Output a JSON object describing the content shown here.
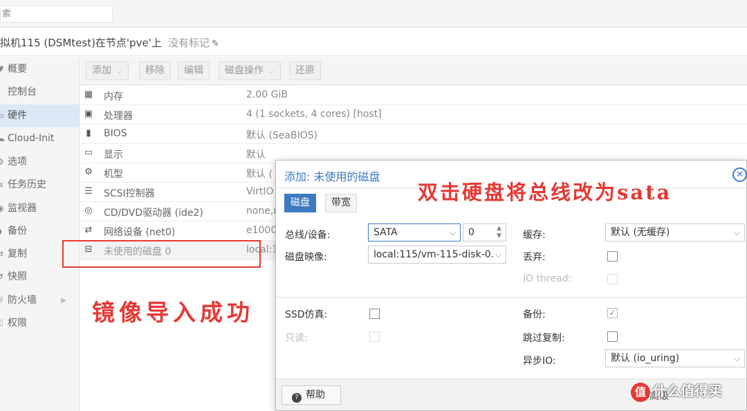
{
  "topbar": {
    "search_text": "索"
  },
  "header": {
    "vm_title": "拟机115 (DSMtest)在节点'pve'上",
    "tag_text": "没有标记"
  },
  "nav": {
    "items": [
      {
        "label": "概要"
      },
      {
        "label": "控制台"
      },
      {
        "label": "硬件"
      },
      {
        "label": "Cloud-Init"
      },
      {
        "label": "选项"
      },
      {
        "label": "任务历史"
      },
      {
        "label": "监视器"
      },
      {
        "label": "备份"
      },
      {
        "label": "复制"
      },
      {
        "label": "快照"
      },
      {
        "label": "防火墙"
      },
      {
        "label": "权限"
      }
    ],
    "active": "硬件"
  },
  "toolbar": {
    "add": "添加",
    "remove": "移除",
    "edit": "编辑",
    "disk_action": "磁盘操作",
    "revert": "还原"
  },
  "hardware": [
    {
      "icon": "memory-icon",
      "name": "内存",
      "value": "2.00 GiB"
    },
    {
      "icon": "cpu-icon",
      "name": "处理器",
      "value": "4 (1 sockets, 4 cores) [host]"
    },
    {
      "icon": "bios-icon",
      "name": "BIOS",
      "value": "默认 (SeaBIOS)"
    },
    {
      "icon": "display-icon",
      "name": "显示",
      "value": "默认"
    },
    {
      "icon": "machine-icon",
      "name": "机型",
      "value": "默认 ("
    },
    {
      "icon": "database-icon",
      "name": "SCSI控制器",
      "value": "VirtIO"
    },
    {
      "icon": "cdrom-icon",
      "name": "CD/DVD驱动器 (ide2)",
      "value": "none,m"
    },
    {
      "icon": "network-icon",
      "name": "网络设备 (net0)",
      "value": "e1000"
    },
    {
      "icon": "hdd-icon",
      "name": "未使用的磁盘 0",
      "value": "local:1"
    }
  ],
  "annotations": {
    "import_success": "镜像导入成功",
    "double_click": "双击硬盘将总线改为sata"
  },
  "dialog": {
    "title": "添加: 未使用的磁盘",
    "tabs": [
      "磁盘",
      "带宽"
    ],
    "bus_label": "总线/设备:",
    "bus_value": "SATA",
    "device_number": "0",
    "image_label": "磁盘映像:",
    "image_value": "local:115/vm-115-disk-0.",
    "cache_label": "缓存:",
    "cache_value": "默认 (无缓存)",
    "discard_label": "丢弃:",
    "iothread_label": "IO thread:",
    "ssd_label": "SSD仿真:",
    "readonly_label": "只读:",
    "backup_label": "备份:",
    "skip_replication_label": "跳过复制:",
    "async_io_label": "异步IO:",
    "async_io_value": "默认 (io_uring)",
    "help": "帮助",
    "footer_partial": "高级"
  },
  "watermark": {
    "logo_char": "值",
    "text": "什么值得买"
  },
  "colors": {
    "accent": "#3b7bbf",
    "annotation_red": "#e53935"
  }
}
